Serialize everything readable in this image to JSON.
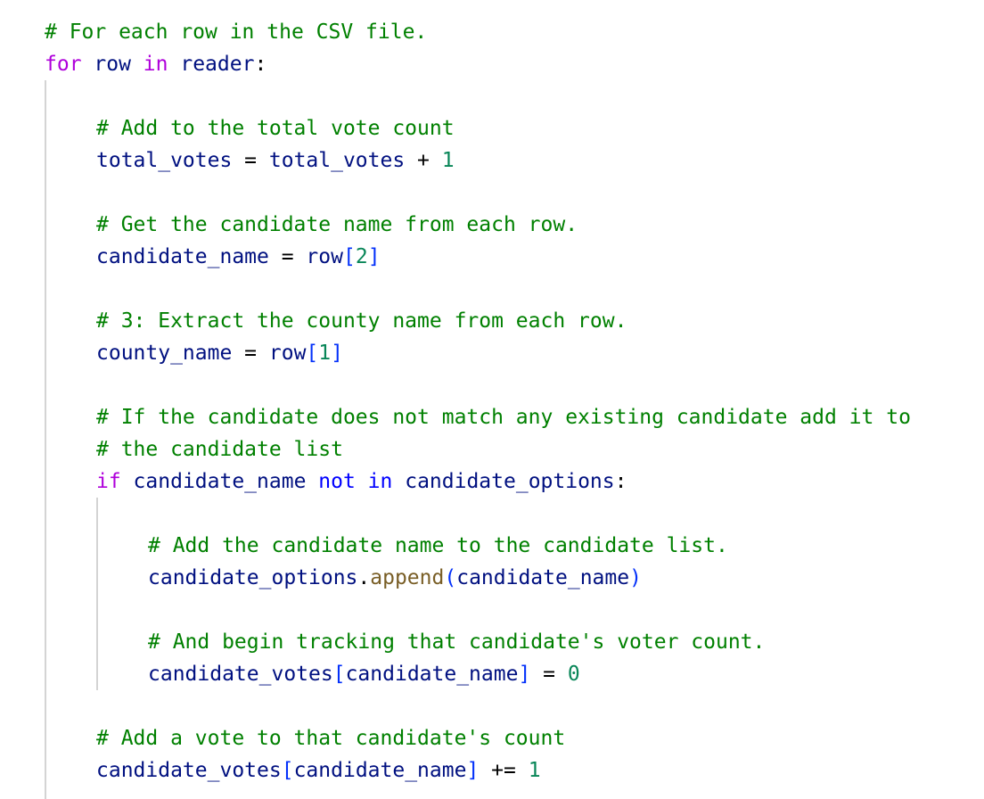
{
  "code": {
    "lines": [
      {
        "indent": 0,
        "tokens": [
          {
            "t": "# For each row in the CSV file.",
            "k": "comment"
          }
        ]
      },
      {
        "indent": 0,
        "tokens": [
          {
            "t": "for",
            "k": "keyword"
          },
          {
            "t": " row ",
            "k": "var"
          },
          {
            "t": "in",
            "k": "keyword"
          },
          {
            "t": " reader",
            "k": "var"
          },
          {
            "t": ":",
            "k": "op"
          }
        ]
      },
      {
        "indent": 0,
        "tokens": []
      },
      {
        "indent": 1,
        "tokens": [
          {
            "t": "# Add to the total vote count",
            "k": "comment"
          }
        ]
      },
      {
        "indent": 1,
        "tokens": [
          {
            "t": "total_votes",
            "k": "var"
          },
          {
            "t": " = ",
            "k": "op"
          },
          {
            "t": "total_votes",
            "k": "var"
          },
          {
            "t": " + ",
            "k": "op"
          },
          {
            "t": "1",
            "k": "num"
          }
        ]
      },
      {
        "indent": 0,
        "tokens": []
      },
      {
        "indent": 1,
        "tokens": [
          {
            "t": "# Get the candidate name from each row.",
            "k": "comment"
          }
        ]
      },
      {
        "indent": 1,
        "tokens": [
          {
            "t": "candidate_name",
            "k": "var"
          },
          {
            "t": " = ",
            "k": "op"
          },
          {
            "t": "row",
            "k": "var"
          },
          {
            "t": "[",
            "k": "bracket"
          },
          {
            "t": "2",
            "k": "num"
          },
          {
            "t": "]",
            "k": "bracket"
          }
        ]
      },
      {
        "indent": 0,
        "tokens": []
      },
      {
        "indent": 1,
        "tokens": [
          {
            "t": "# 3: Extract the county name from each row.",
            "k": "comment"
          }
        ]
      },
      {
        "indent": 1,
        "tokens": [
          {
            "t": "county_name",
            "k": "var"
          },
          {
            "t": " = ",
            "k": "op"
          },
          {
            "t": "row",
            "k": "var"
          },
          {
            "t": "[",
            "k": "bracket"
          },
          {
            "t": "1",
            "k": "num"
          },
          {
            "t": "]",
            "k": "bracket"
          }
        ]
      },
      {
        "indent": 0,
        "tokens": []
      },
      {
        "indent": 1,
        "tokens": [
          {
            "t": "# If the candidate does not match any existing candidate add it to",
            "k": "comment"
          }
        ]
      },
      {
        "indent": 1,
        "tokens": [
          {
            "t": "# the candidate list",
            "k": "comment"
          }
        ]
      },
      {
        "indent": 1,
        "tokens": [
          {
            "t": "if",
            "k": "keyword"
          },
          {
            "t": " candidate_name ",
            "k": "var"
          },
          {
            "t": "not",
            "k": "kwop"
          },
          {
            "t": " ",
            "k": "var"
          },
          {
            "t": "in",
            "k": "kwop"
          },
          {
            "t": " candidate_options",
            "k": "var"
          },
          {
            "t": ":",
            "k": "op"
          }
        ]
      },
      {
        "indent": 0,
        "tokens": []
      },
      {
        "indent": 2,
        "tokens": [
          {
            "t": "# Add the candidate name to the candidate list.",
            "k": "comment"
          }
        ]
      },
      {
        "indent": 2,
        "tokens": [
          {
            "t": "candidate_options",
            "k": "var"
          },
          {
            "t": ".",
            "k": "op"
          },
          {
            "t": "append",
            "k": "func"
          },
          {
            "t": "(",
            "k": "bracket"
          },
          {
            "t": "candidate_name",
            "k": "var"
          },
          {
            "t": ")",
            "k": "bracket"
          }
        ]
      },
      {
        "indent": 0,
        "tokens": []
      },
      {
        "indent": 2,
        "tokens": [
          {
            "t": "# And begin tracking that candidate's voter count.",
            "k": "comment"
          }
        ]
      },
      {
        "indent": 2,
        "tokens": [
          {
            "t": "candidate_votes",
            "k": "var"
          },
          {
            "t": "[",
            "k": "bracket"
          },
          {
            "t": "candidate_name",
            "k": "var"
          },
          {
            "t": "]",
            "k": "bracket"
          },
          {
            "t": " = ",
            "k": "op"
          },
          {
            "t": "0",
            "k": "num"
          }
        ]
      },
      {
        "indent": 0,
        "tokens": []
      },
      {
        "indent": 1,
        "tokens": [
          {
            "t": "# Add a vote to that candidate's count",
            "k": "comment"
          }
        ]
      },
      {
        "indent": 1,
        "tokens": [
          {
            "t": "candidate_votes",
            "k": "var"
          },
          {
            "t": "[",
            "k": "bracket"
          },
          {
            "t": "candidate_name",
            "k": "var"
          },
          {
            "t": "]",
            "k": "bracket"
          },
          {
            "t": " += ",
            "k": "op"
          },
          {
            "t": "1",
            "k": "num"
          }
        ]
      }
    ]
  },
  "colors": {
    "comment": "#008000",
    "keyword": "#af00db",
    "keyword_operator": "#0000ff",
    "variable": "#001080",
    "number": "#098658",
    "bracket": "#0431fa",
    "function": "#795e26",
    "indent_guide": "#d4d4d4",
    "background": "#ffffff"
  }
}
